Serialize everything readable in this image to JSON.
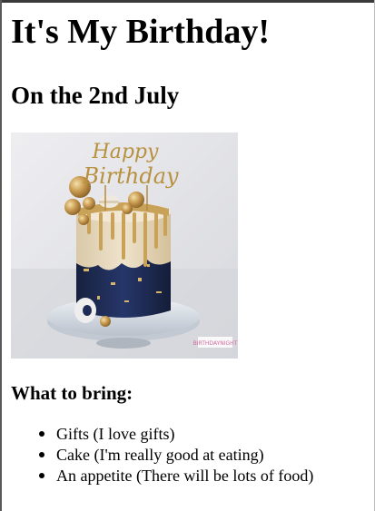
{
  "page": {
    "title": "It's My Birthday!",
    "subtitle": "On the 2nd July"
  },
  "photo": {
    "topper_text_line1": "Happy",
    "topper_text_line2": "Birthday",
    "watermark": "BIRTHDAYNIGHT",
    "colors": {
      "background": "#e6e6e9",
      "cream": "#e9dcc4",
      "navy": "#1e2c55",
      "gold": "#c9a25a",
      "plate": "#d8dde4"
    }
  },
  "bring": {
    "heading": "What to bring:",
    "items": [
      "Gifts (I love gifts)",
      "Cake (I'm really good at eating)",
      "An appetite (There will be lots of food)"
    ]
  }
}
